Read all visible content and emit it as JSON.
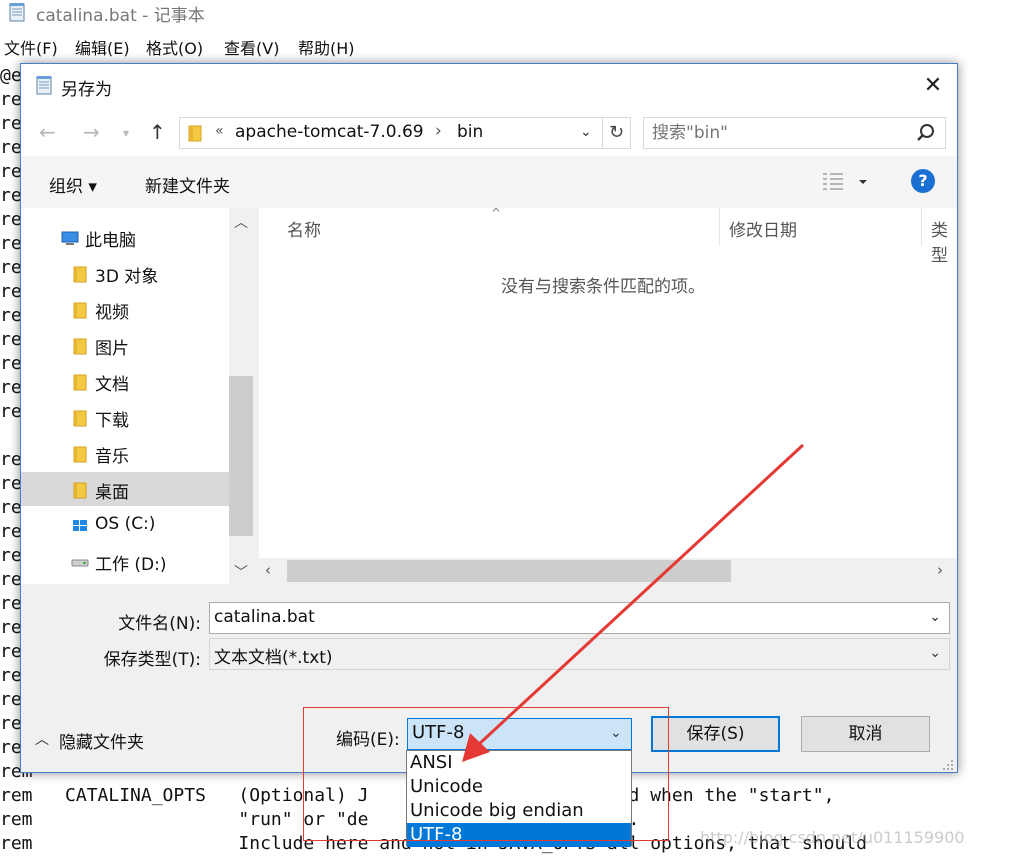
{
  "notepad": {
    "title": "catalina.bat - 记事本",
    "menu": [
      "文件(F)",
      "编辑(E)",
      "格式(O)",
      "查看(V)",
      "帮助(H)"
    ],
    "lines": [
      "@e",
      "re",
      "re",
      "re",
      "re",
      "re",
      "re",
      "re",
      "re",
      "re",
      "re",
      "re",
      "re",
      "re",
      "re",
      "",
      "re",
      "re",
      "re",
      "re",
      "re",
      "re",
      "re",
      "re",
      "re",
      "re",
      "re",
      "re",
      "re",
      "rem",
      "rem   CATALINA_OPTS   (Optional) J                     used when the \"start\",",
      "rem                   \"run\" or \"de                   cuted.",
      "rem                   Include here and not in JAVA_OPTS all options, that should"
    ]
  },
  "dialog": {
    "title": "另存为",
    "close": "✕",
    "address": {
      "chevron": "«",
      "segments": [
        "apache-tomcat-7.0.69",
        "bin"
      ],
      "separator": "›"
    },
    "search_placeholder": "搜索\"bin\"",
    "toolbar": {
      "organize": "组织 ▾",
      "new_folder": "新建文件夹",
      "help": "?"
    },
    "nav_items": [
      {
        "label": "此电脑",
        "icon": "computer-icon"
      },
      {
        "label": "3D 对象",
        "icon": "3d-objects-icon"
      },
      {
        "label": "视频",
        "icon": "video-folder-icon"
      },
      {
        "label": "图片",
        "icon": "pictures-folder-icon"
      },
      {
        "label": "文档",
        "icon": "documents-folder-icon"
      },
      {
        "label": "下载",
        "icon": "downloads-folder-icon"
      },
      {
        "label": "音乐",
        "icon": "music-folder-icon"
      },
      {
        "label": "桌面",
        "icon": "desktop-folder-icon",
        "selected": true
      },
      {
        "label": "OS (C:)",
        "icon": "windows-drive-icon"
      },
      {
        "label": "工作 (D:)",
        "icon": "drive-icon"
      }
    ],
    "columns": [
      "名称",
      "修改日期",
      "类型"
    ],
    "empty_message": "没有与搜索条件匹配的项。",
    "filename_label": "文件名(N):",
    "filename_value": "catalina.bat",
    "filetype_label": "保存类型(T):",
    "filetype_value": "文本文档(*.txt)",
    "hide_folders": "隐藏文件夹",
    "encoding_label": "编码(E):",
    "encoding_value": "UTF-8",
    "encoding_options": [
      "ANSI",
      "Unicode",
      "Unicode big endian",
      "UTF-8"
    ],
    "encoding_selected_index": 3,
    "save_button": "保存(S)",
    "cancel_button": "取消"
  },
  "annotation_color": "#e53935",
  "watermark": "http://blog.csdn.net/u011159900"
}
